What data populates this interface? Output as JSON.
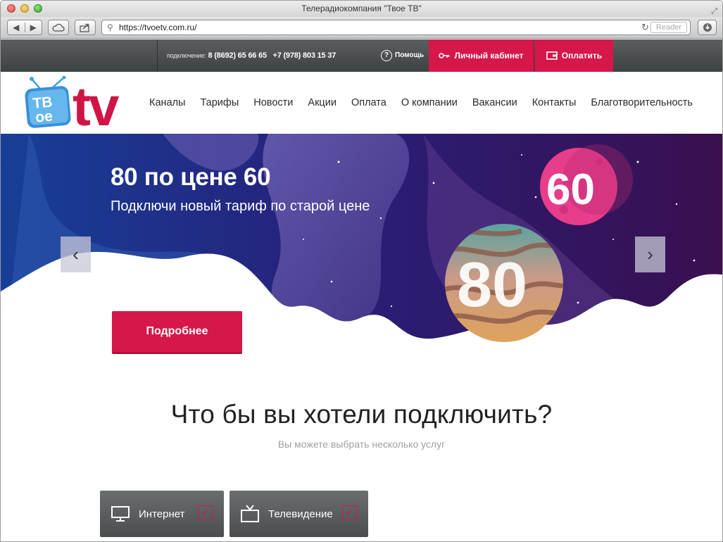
{
  "browser": {
    "window_title": "Телерадиокомпания \"Твое ТВ\"",
    "url": "https://tvoetv.com.ru/",
    "reader_label": "Reader",
    "nav_back": "◀",
    "nav_forward": "▶"
  },
  "topbar": {
    "connect_label": "подключение:",
    "phone1": "8 (8692) 65 66 65",
    "phone2": "+7 (978) 803 15 37",
    "help_label": "Помощь",
    "cabinet_label": "Личный кабинет",
    "pay_label": "Оплатить",
    "accent": "#d5174a"
  },
  "nav": {
    "items": [
      "Каналы",
      "Тарифы",
      "Новости",
      "Акции",
      "Оплата",
      "О компании",
      "Вакансии",
      "Контакты",
      "Благотворительность"
    ]
  },
  "logo": {
    "tv_letters": "ТВ",
    "oe_letters": "ое",
    "tv_latin": "tv"
  },
  "hero": {
    "title": "80 по цене 60",
    "subtitle": "Подключи новый тариф по старой цене",
    "planet_small": "60",
    "planet_big": "80",
    "more_label": "Подробнее",
    "prev_arrow": "‹",
    "next_arrow": "›"
  },
  "services": {
    "title": "Что бы вы хотели подключить?",
    "subtitle": "Вы можете выбрать несколько услуг",
    "items": [
      {
        "label": "Интернет",
        "icon": "monitor-icon",
        "checked": true
      },
      {
        "label": "Телевидение",
        "icon": "tv-icon",
        "checked": true
      }
    ],
    "check_mark": "✓"
  }
}
